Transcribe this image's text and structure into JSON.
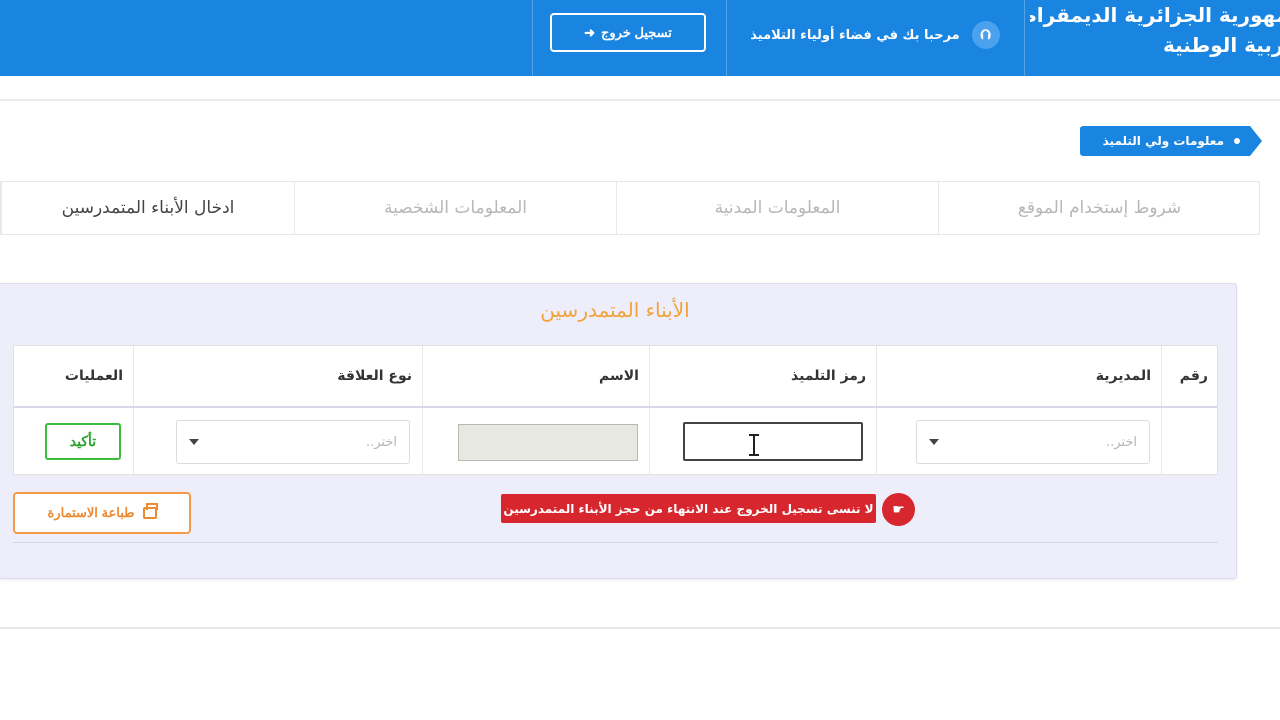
{
  "header": {
    "title_line1": "وزارة التربية الوطنية",
    "title_line2": "الجمهورية الجزائرية الديمقراطية الشعبية",
    "welcome_text": "مرحبا بك في فضاء أولياء التلاميذ",
    "welcome_icon": "home-arrow-icon",
    "logout_label": "تسجيل خروج",
    "logout_icon": "sign-out-icon",
    "color": "#1a85e0"
  },
  "breadcrumb": {
    "label": "معلومات ولي التلميذ"
  },
  "tabs": [
    {
      "label": "شروط إستخدام الموقع",
      "active": false
    },
    {
      "label": "المعلومات المدنية",
      "active": false
    },
    {
      "label": "المعلومات الشخصية",
      "active": false
    },
    {
      "label": "ادخال الأبناء المتمدرسين",
      "active": true
    }
  ],
  "panel": {
    "title": "الأبناء المتمدرسين",
    "title_color": "#f0a33a"
  },
  "table": {
    "headers": {
      "number": "رقم",
      "directorate": "المديرية",
      "student_code": "رمز التلميذ",
      "name": "الاسم",
      "relation": "نوع العلاقة",
      "actions": "العمليات"
    },
    "row": {
      "directorate_placeholder": "اختر..",
      "student_code_value": "",
      "name_value": "",
      "relation_placeholder": "اختر..",
      "confirm_label": "تأكيد"
    }
  },
  "alert": {
    "text": "لا تنسى تسجيل الخروج عند الانتهاء من حجز الأبناء المتمدرسين",
    "icon": "hand-pointer-icon",
    "color": "#d8262e"
  },
  "print": {
    "label": "طباعة الاستمارة",
    "icon": "printer-icon",
    "color": "#f29a4a"
  }
}
